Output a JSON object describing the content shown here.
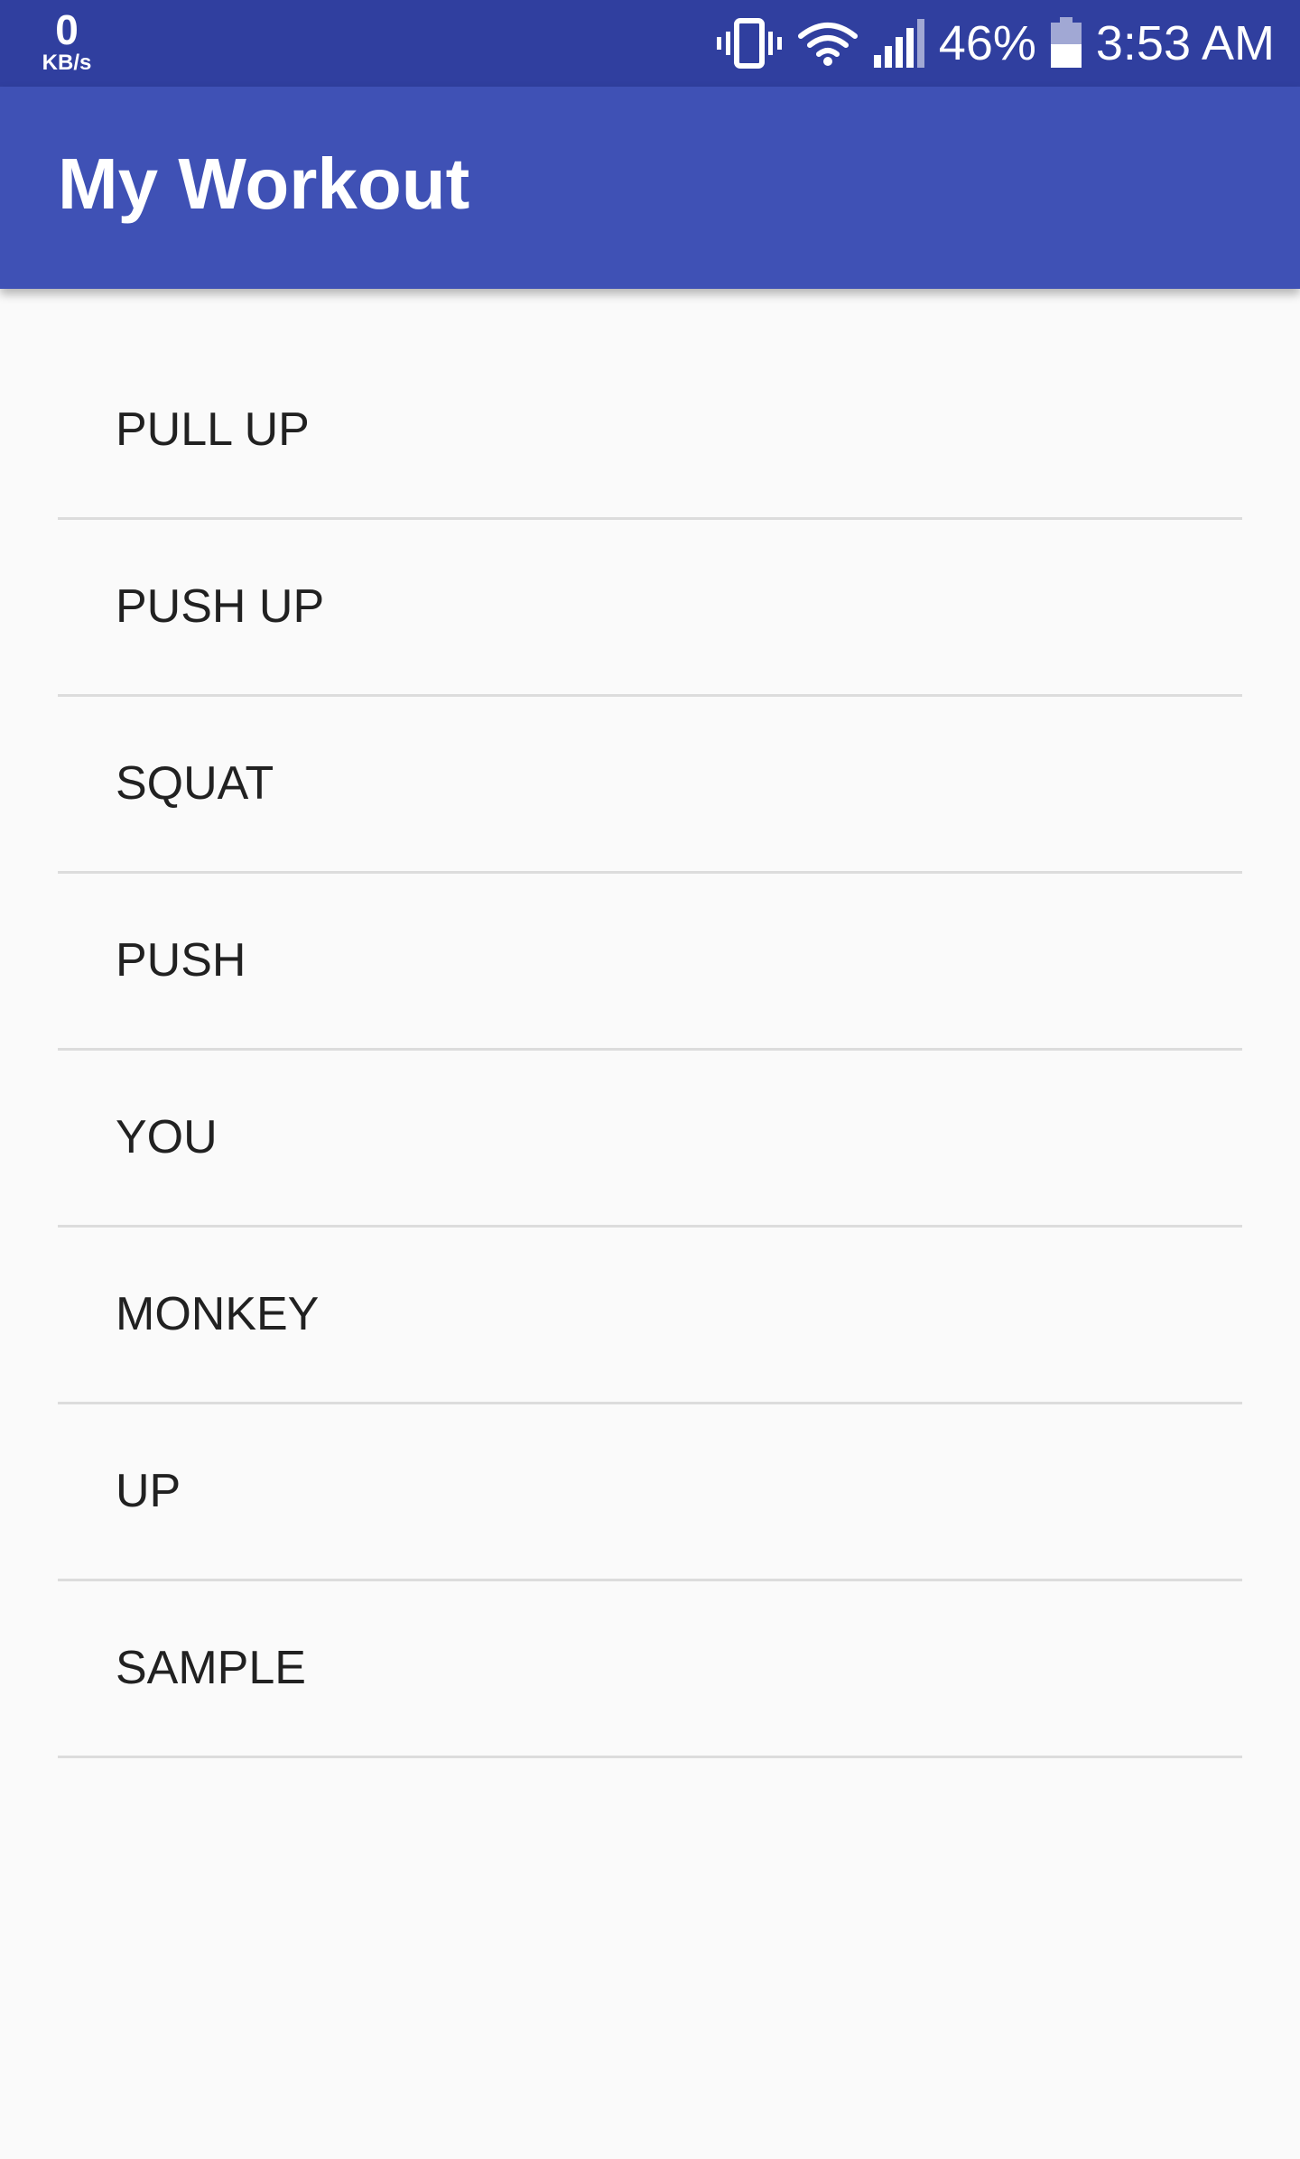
{
  "status_bar": {
    "net_speed_value": "0",
    "net_speed_unit": "KB/s",
    "battery_percent": "46%",
    "time": "3:53 AM",
    "icons": [
      "vibrate-icon",
      "wifi-icon",
      "signal-icon",
      "battery-icon"
    ]
  },
  "app_bar": {
    "title": "My Workout"
  },
  "exercises": [
    {
      "label": "PULL UP"
    },
    {
      "label": "PUSH UP"
    },
    {
      "label": "SQUAT"
    },
    {
      "label": "PUSH"
    },
    {
      "label": "YOU"
    },
    {
      "label": "MONKEY"
    },
    {
      "label": "UP"
    },
    {
      "label": "SAMPLE"
    }
  ],
  "colors": {
    "status_bar": "#303f9f",
    "app_bar": "#3f51b5",
    "background": "#fafafa",
    "divider": "#dcdcdc",
    "list_text": "#212121"
  }
}
